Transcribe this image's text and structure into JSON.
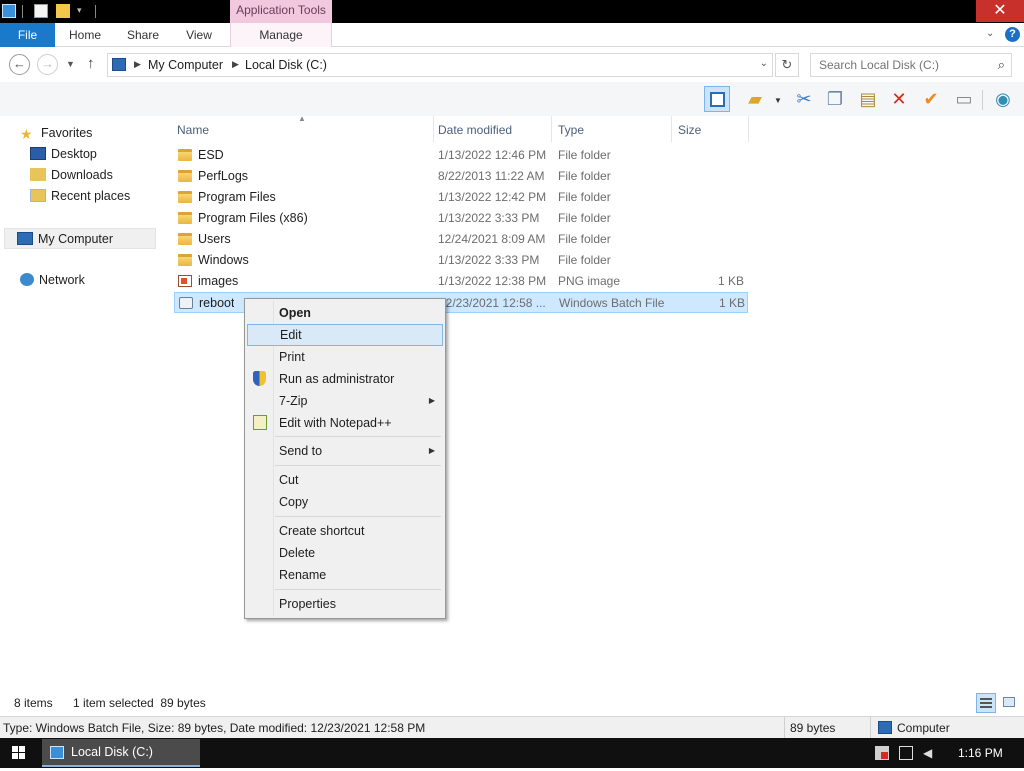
{
  "window": {
    "contextual_group": "Application Tools",
    "close_glyph": "✕"
  },
  "ribbon": {
    "tabs": [
      "File",
      "Home",
      "Share",
      "View",
      "Manage"
    ],
    "help": "?"
  },
  "address": {
    "crumbs": [
      "My Computer",
      "Local Disk (C:)"
    ],
    "search_placeholder": "Search Local Disk (C:)"
  },
  "nav": {
    "favorites": "Favorites",
    "desktop": "Desktop",
    "downloads": "Downloads",
    "recent": "Recent places",
    "my_computer": "My Computer",
    "network": "Network"
  },
  "columns": [
    "Name",
    "Date modified",
    "Type",
    "Size"
  ],
  "files": [
    {
      "name": "ESD",
      "date": "1/13/2022 12:46 PM",
      "type": "File folder",
      "size": "",
      "icon": "folder-icon"
    },
    {
      "name": "PerfLogs",
      "date": "8/22/2013 11:22 AM",
      "type": "File folder",
      "size": "",
      "icon": "folder-icon"
    },
    {
      "name": "Program Files",
      "date": "1/13/2022 12:42 PM",
      "type": "File folder",
      "size": "",
      "icon": "folder-icon"
    },
    {
      "name": "Program Files (x86)",
      "date": "1/13/2022 3:33 PM",
      "type": "File folder",
      "size": "",
      "icon": "folder-icon"
    },
    {
      "name": "Users",
      "date": "12/24/2021 8:09 AM",
      "type": "File folder",
      "size": "",
      "icon": "folder-icon"
    },
    {
      "name": "Windows",
      "date": "1/13/2022 3:33 PM",
      "type": "File folder",
      "size": "",
      "icon": "folder-icon"
    },
    {
      "name": "images",
      "date": "1/13/2022 12:38 PM",
      "type": "PNG image",
      "size": "1 KB",
      "icon": "png-file-icon"
    },
    {
      "name": "reboot",
      "date": "12/23/2021 12:58 ...",
      "type": "Windows Batch File",
      "size": "1 KB",
      "icon": "batch-file-icon",
      "selected": true
    }
  ],
  "context_menu": {
    "open": "Open",
    "edit": "Edit",
    "print": "Print",
    "run_as_admin": "Run as administrator",
    "zip": "7-Zip",
    "notepad": "Edit with Notepad++",
    "send_to": "Send to",
    "cut": "Cut",
    "copy": "Copy",
    "create_shortcut": "Create shortcut",
    "delete": "Delete",
    "rename": "Rename",
    "properties": "Properties"
  },
  "status": {
    "items": "8 items",
    "selected": "1 item selected  89 bytes"
  },
  "details": {
    "text": "Type: Windows Batch File, Size: 89 bytes, Date modified: 12/23/2021 12:58 PM",
    "size": "89 bytes",
    "location": "Computer"
  },
  "taskbar": {
    "item": "Local Disk (C:)",
    "clock": "1:16 PM"
  },
  "colors": {
    "accent": "#1979ca",
    "selection": "#cde8ff",
    "menu_highlight": "#d9e9f8",
    "close": "#c7302b"
  }
}
